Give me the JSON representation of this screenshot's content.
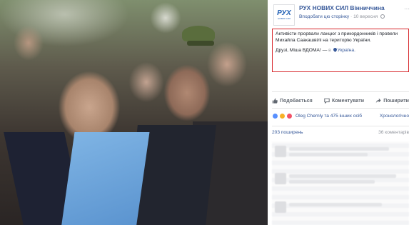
{
  "page": {
    "name": "РУХ НОВИХ СИЛ Вінниччина",
    "like_page": "Вподобати цю сторінку",
    "separator": "·",
    "date": "10 вересня",
    "more": "···",
    "logo_text": "РУХ",
    "logo_sub": "НОВИХ СИЛ"
  },
  "post": {
    "text": "Активісти прорвали ланцюг з прикордонників і провели Михайла Саакашвілі на територію України.",
    "line2_prefix": "Друзі, Міша ВДОМА! —",
    "at": "в",
    "place": "Україна."
  },
  "actions": {
    "like": "Подобається",
    "comment": "Коментувати",
    "share": "Поширити"
  },
  "reactions": {
    "summary": "Oleg Chernly та 475 інших осіб",
    "chronology": "Хронологічно"
  },
  "stats": {
    "shares": "203 поширень",
    "comments": "36 коментарів"
  },
  "colors": {
    "accent": "#365899",
    "highlight_border": "#d7262b"
  },
  "icons": {
    "like": "thumbs-up-icon",
    "comment": "speech-bubble-icon",
    "share": "share-arrow-icon",
    "location": "pin-icon",
    "privacy": "globe-icon"
  }
}
